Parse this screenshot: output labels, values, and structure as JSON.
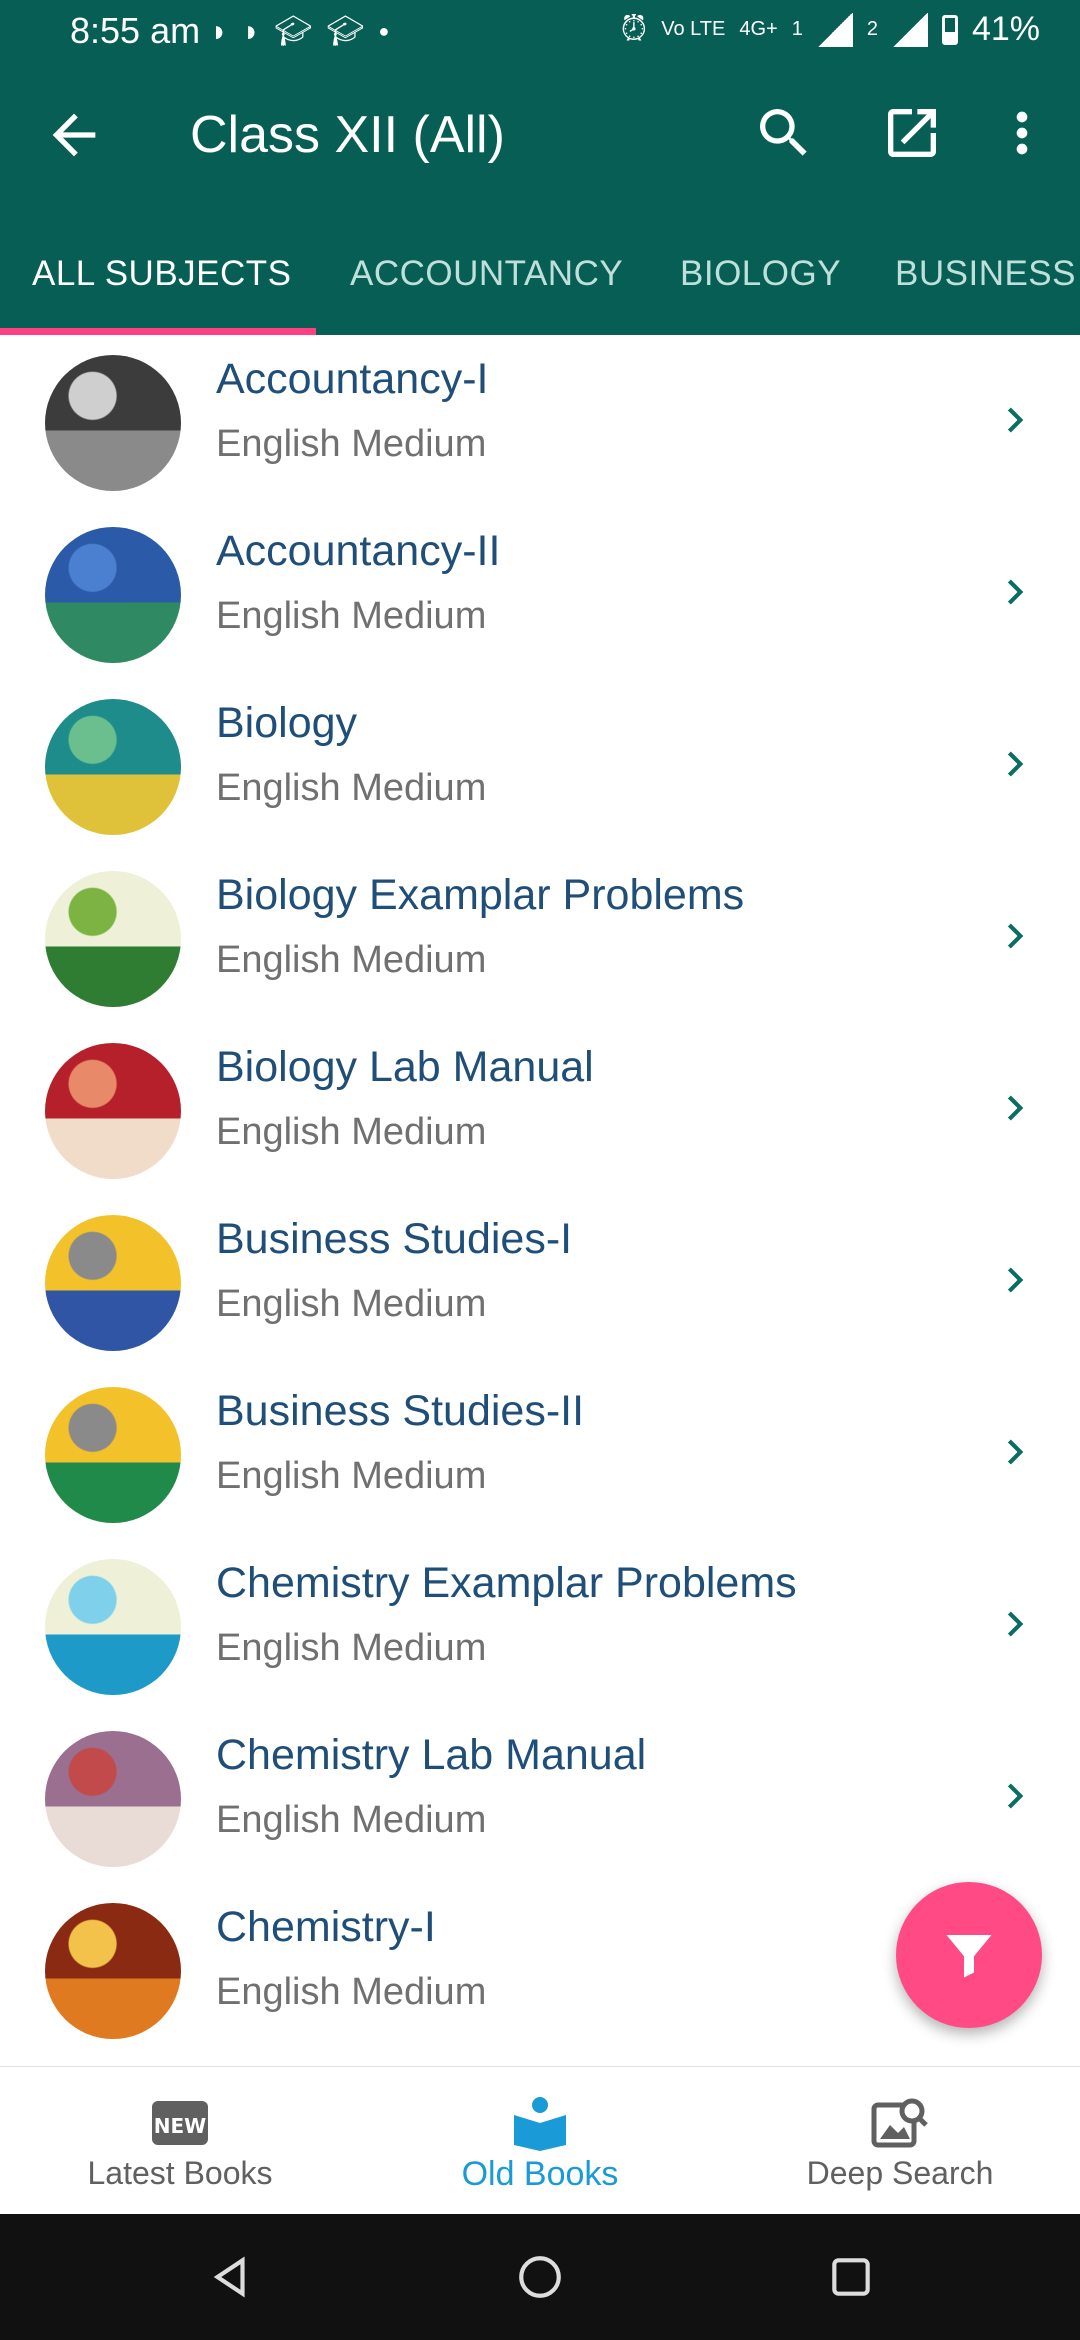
{
  "status_bar": {
    "time": "8:55 am",
    "battery": "41%",
    "network": "4G+",
    "sim1": "1",
    "sim2": "2",
    "volte": "Vo LTE"
  },
  "app_bar": {
    "title": "Class XII (All)",
    "icons": [
      "back-arrow-icon",
      "search-icon",
      "open-external-icon",
      "more-vert-icon"
    ]
  },
  "tabs": [
    {
      "label": "ALL SUBJECTS",
      "active": true
    },
    {
      "label": "ACCOUNTANCY",
      "active": false
    },
    {
      "label": "BIOLOGY",
      "active": false
    },
    {
      "label": "BUSINESS STUDIES",
      "active": false
    }
  ],
  "books": [
    {
      "title": "Accountancy-I",
      "medium": "English Medium",
      "thumb_colors": [
        "#3c3c3c",
        "#8a8a8a",
        "#cfcfcf"
      ]
    },
    {
      "title": "Accountancy-II",
      "medium": "English Medium",
      "thumb_colors": [
        "#2a5aa8",
        "#2f8a63",
        "#4b7fd0"
      ]
    },
    {
      "title": "Biology",
      "medium": "English Medium",
      "thumb_colors": [
        "#1d8c8a",
        "#e0c23a",
        "#6bbf8f"
      ]
    },
    {
      "title": "Biology Examplar Problems",
      "medium": "English Medium",
      "thumb_colors": [
        "#eef0d8",
        "#2e7d32",
        "#7cb342"
      ]
    },
    {
      "title": "Biology Lab Manual",
      "medium": "English Medium",
      "thumb_colors": [
        "#b5202a",
        "#f0dcc8",
        "#e88a6a"
      ]
    },
    {
      "title": "Business Studies-I",
      "medium": "English Medium",
      "thumb_colors": [
        "#f3c22a",
        "#2f55a4",
        "#8a8a8a"
      ]
    },
    {
      "title": "Business Studies-II",
      "medium": "English Medium",
      "thumb_colors": [
        "#f3c22a",
        "#1f8a4a",
        "#8a8a8a"
      ]
    },
    {
      "title": "Chemistry Examplar Problems",
      "medium": "English Medium",
      "thumb_colors": [
        "#eef0d8",
        "#1d9ac8",
        "#7fd0ea"
      ]
    },
    {
      "title": "Chemistry Lab Manual",
      "medium": "English Medium",
      "thumb_colors": [
        "#9b6f8f",
        "#e9dcd6",
        "#c24a4a"
      ]
    },
    {
      "title": "Chemistry-I",
      "medium": "English Medium",
      "thumb_colors": [
        "#8a2a12",
        "#e07a20",
        "#f3c24a"
      ]
    }
  ],
  "bottom_nav": [
    {
      "label": "Latest Books",
      "icon": "new-badge-icon",
      "active": false
    },
    {
      "label": "Old Books",
      "icon": "book-reader-icon",
      "active": true
    },
    {
      "label": "Deep Search",
      "icon": "image-search-icon",
      "active": false
    }
  ],
  "fab": {
    "icon": "filter-icon"
  },
  "colors": {
    "primary": "#075e55",
    "accent": "#ff4a86",
    "title_text": "#1f4e79",
    "active_nav": "#1a9ad6",
    "chevron": "#0b6e62"
  }
}
